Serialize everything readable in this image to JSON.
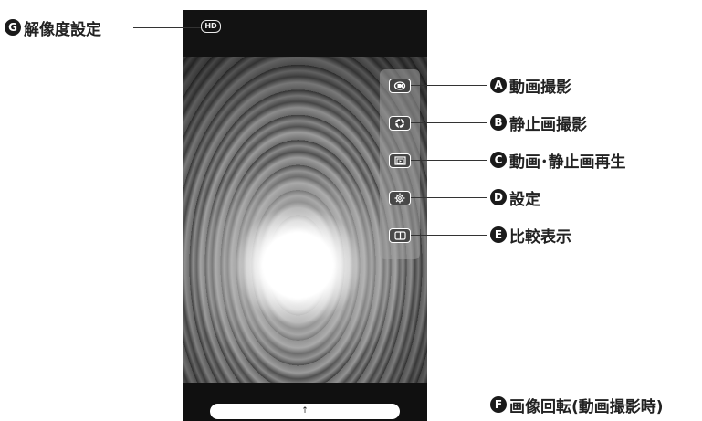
{
  "screen": {
    "resolution_badge": "HD",
    "rotate_bar_arrow": "↑"
  },
  "toolbar": {
    "buttons": [
      {
        "icon": "video-record-icon"
      },
      {
        "icon": "camera-shutter-icon"
      },
      {
        "icon": "media-playback-icon"
      },
      {
        "icon": "gear-icon"
      },
      {
        "icon": "compare-split-icon"
      }
    ]
  },
  "callouts": {
    "a": {
      "letter": "A",
      "text": "動画撮影"
    },
    "b": {
      "letter": "B",
      "text": "静止画撮影"
    },
    "c": {
      "letter": "C",
      "text": "動画･静止画再生"
    },
    "d": {
      "letter": "D",
      "text": "設定"
    },
    "e": {
      "letter": "E",
      "text": "比較表示"
    },
    "f": {
      "letter": "F",
      "text": "画像回転(動画撮影時)"
    },
    "g": {
      "letter": "G",
      "text": "解像度設定"
    }
  }
}
